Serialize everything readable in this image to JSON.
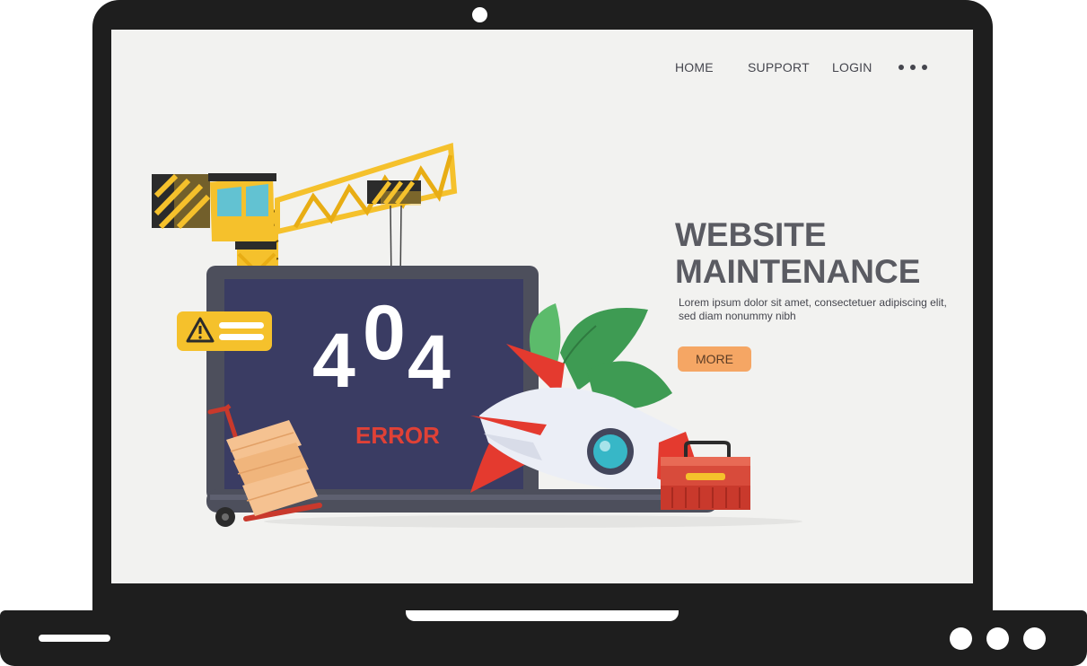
{
  "nav": {
    "items": [
      {
        "label": "HOME"
      },
      {
        "label": "SUPPORT"
      },
      {
        "label": "LOGIN"
      }
    ],
    "more_icon": "ellipsis-icon"
  },
  "hero": {
    "title_line1": "WEBSITE",
    "title_line2": "MAINTENANCE",
    "body": "Lorem ipsum dolor sit amet, consectetuer adipiscing elit, sed diam nonummy nibh",
    "button_label": "MORE"
  },
  "illustration": {
    "code_4a": "4",
    "code_0": "0",
    "code_4b": "4",
    "error_label": "ERROR",
    "icons": [
      "construction-crane-icon",
      "warning-icon",
      "hand-truck-icon",
      "rocket-icon",
      "plant-icon",
      "toolbox-icon"
    ]
  },
  "colors": {
    "frame": "#1e1e1e",
    "screen_bg": "#f2f2f0",
    "inner_screen": "#3a3c63",
    "crane_yellow": "#f5c12c",
    "error_red": "#e04136",
    "button": "#f5a664",
    "headline": "#5a5b62"
  }
}
